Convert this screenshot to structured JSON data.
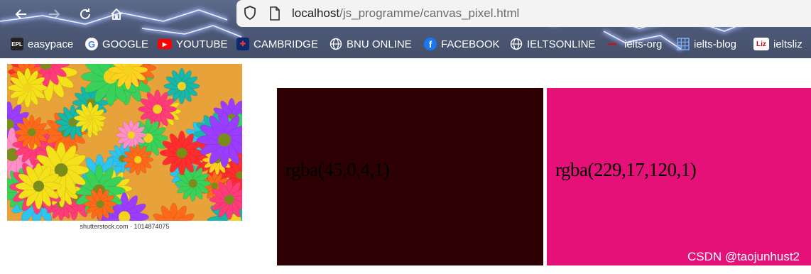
{
  "browser": {
    "url_host": "localhost",
    "url_path": "/js_programme/canvas_pixel.html"
  },
  "bookmarks": [
    {
      "label": "easypace",
      "icon": "easypace-logo-icon"
    },
    {
      "label": "GOOGLE",
      "icon": "google-logo-icon"
    },
    {
      "label": "YOUTUBE",
      "icon": "youtube-logo-icon"
    },
    {
      "label": "CAMBRIDGE",
      "icon": "cambridge-logo-icon"
    },
    {
      "label": "BNU ONLINE",
      "icon": "globe-icon"
    },
    {
      "label": "FACEBOOK",
      "icon": "facebook-logo-icon"
    },
    {
      "label": "IELTSONLINE",
      "icon": "globe-icon"
    },
    {
      "label": "ielts-org",
      "icon": "ielts-logo-icon"
    },
    {
      "label": "ielts-blog",
      "icon": "grid-icon"
    },
    {
      "label": "ieltsliz",
      "icon": "liz-logo-icon"
    }
  ],
  "page": {
    "image_caption": "shutterstock.com · 1014874075",
    "swatches": [
      {
        "label": "rgba(45,0,4,1)",
        "color": "#2d0004"
      },
      {
        "label": "rgba(229,17,120,1)",
        "color": "#e51178"
      }
    ],
    "watermark": "CSDN @taojunhust2"
  },
  "colors": {
    "chrome_bg": "#4d5a78",
    "urlbar_bg": "#f3f3f3"
  }
}
